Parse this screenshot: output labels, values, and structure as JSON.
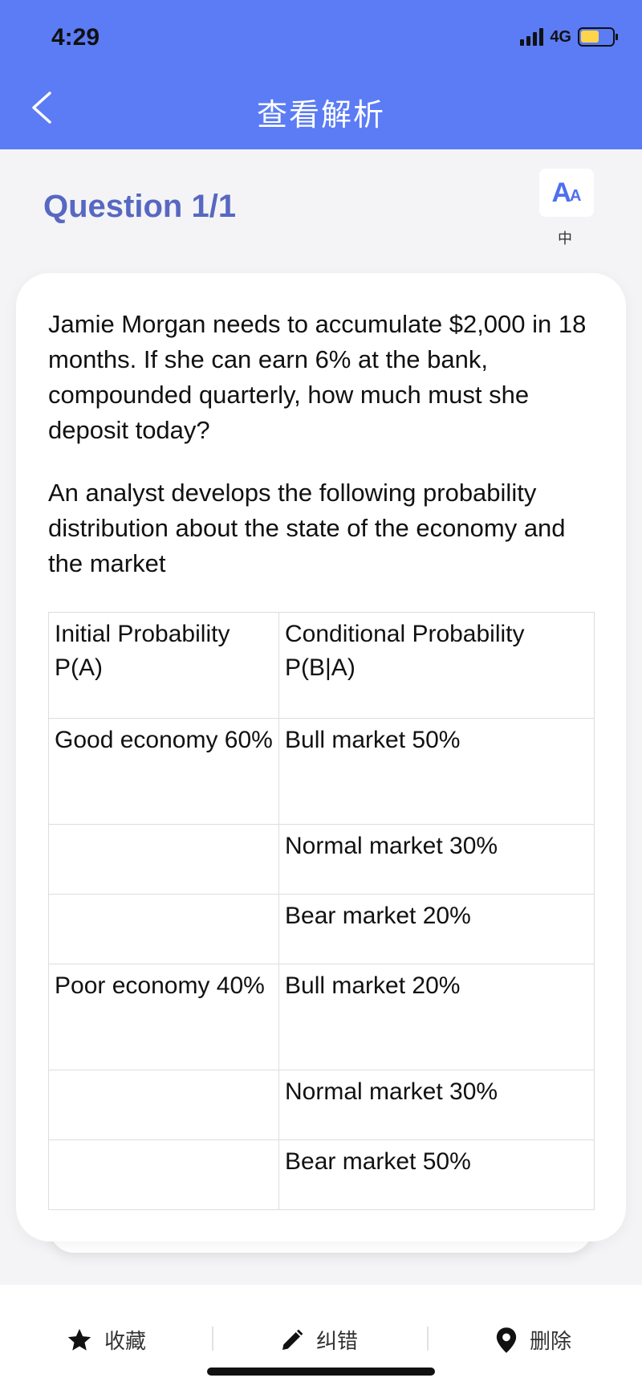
{
  "status_bar": {
    "time": "4:29",
    "network": "4G"
  },
  "nav": {
    "title": "查看解析"
  },
  "question_header": "Question 1/1",
  "font_control": {
    "glyph_large": "A",
    "glyph_small": "A",
    "size_label": "中"
  },
  "content": {
    "question": "Jamie Morgan needs to accumulate $2,000 in 18 months. If she can earn 6% at the bank, compounded quarterly, how much must she deposit today?",
    "intro": "An analyst develops the following probability distribution about the state of the economy and the market",
    "table": {
      "headers": [
        "Initial Probability P(A)",
        "Conditional Probability P(B|A)"
      ],
      "rows": [
        [
          "Good economy 60%",
          "Bull market 50%"
        ],
        [
          "",
          "Normal market 30%"
        ],
        [
          "",
          "Bear market 20%"
        ],
        [
          "Poor economy 40%",
          "Bull market 20%"
        ],
        [
          "",
          "Normal market 30%"
        ],
        [
          "",
          "Bear market 50%"
        ]
      ]
    }
  },
  "bottom_bar": {
    "favorite_label": "收藏",
    "report_label": "纠错",
    "delete_label": "删除"
  },
  "colors": {
    "header_bg": "#5b7cf5",
    "accent": "#5768c2",
    "battery": "#ffd44d"
  }
}
